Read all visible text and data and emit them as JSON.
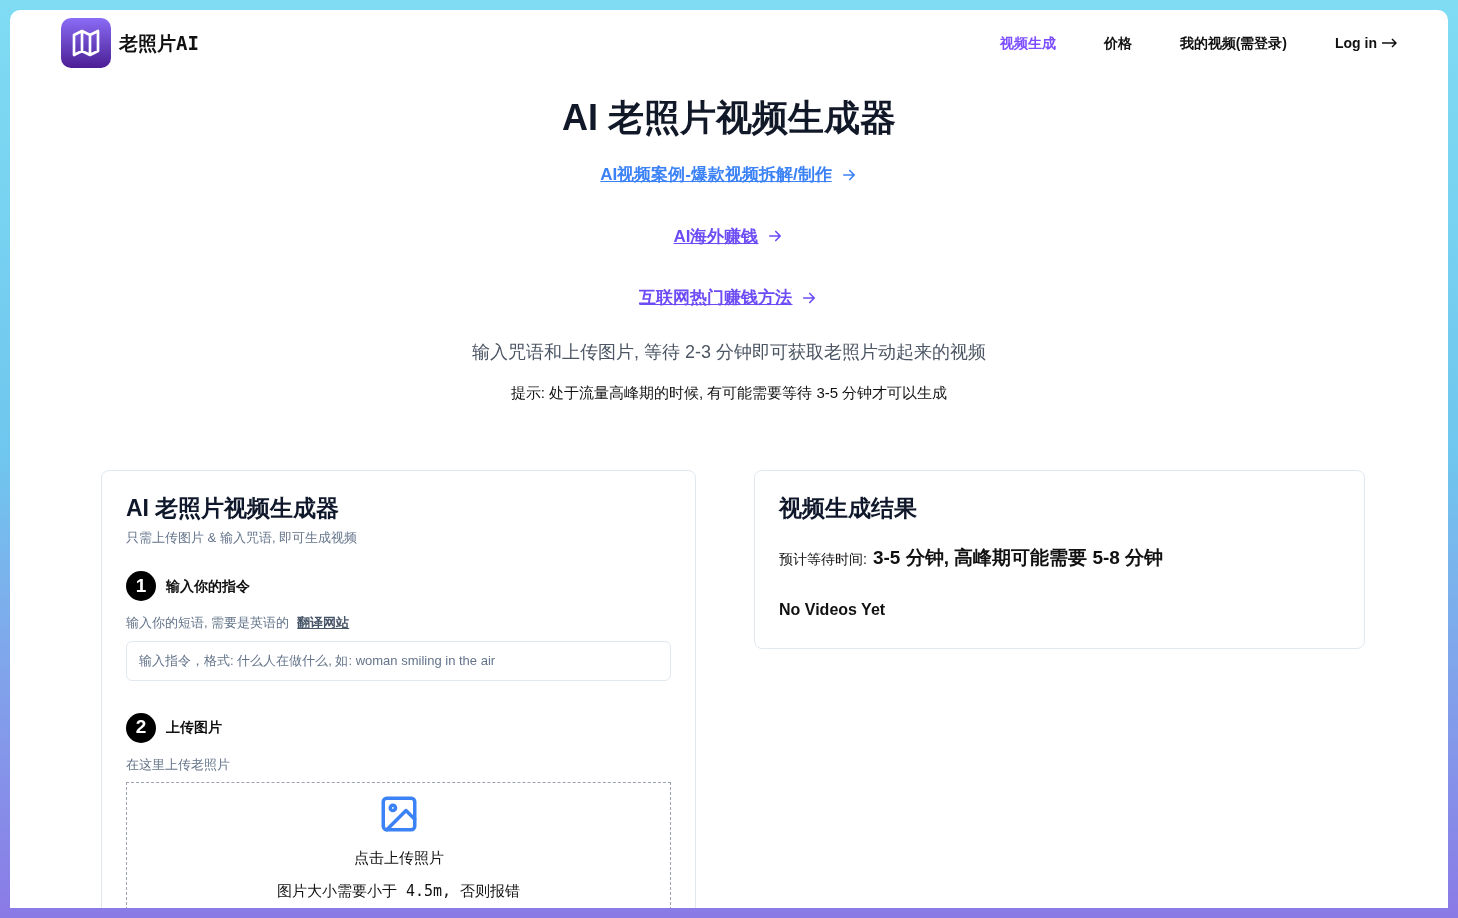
{
  "header": {
    "logo_text": "老照片AI",
    "nav": [
      {
        "label": "视频生成",
        "selected": true
      },
      {
        "label": "价格",
        "selected": false
      },
      {
        "label": "我的视频(需登录)",
        "selected": false
      }
    ],
    "login": "Log in"
  },
  "hero": {
    "title": "AI 老照片视频生成器",
    "links": [
      {
        "label": "AI视频案例-爆款视频拆解/制作",
        "color": "#3b82f6"
      },
      {
        "label": "AI海外赚钱",
        "color": "#6d4cf5"
      },
      {
        "label": "互联网热门赚钱方法",
        "color": "#6d4cf5"
      }
    ],
    "subtitle": "输入咒语和上传图片, 等待 2-3 分钟即可获取老照片动起来的视频",
    "tip": "提示: 处于流量高峰期的时候, 有可能需要等待 3-5 分钟才可以生成"
  },
  "generator": {
    "title": "AI 老照片视频生成器",
    "subtitle": "只需上传图片 & 输入咒语, 即可生成视频",
    "step1": {
      "number": "1",
      "title": "输入你的指令",
      "hint": "输入你的短语, 需要是英语的",
      "link": "翻译网站",
      "placeholder": "输入指令，格式: 什么人在做什么, 如: woman smiling in the air"
    },
    "step2": {
      "number": "2",
      "title": "上传图片",
      "hint": "在这里上传老照片",
      "upload_label": "点击上传照片",
      "upload_note": "图片大小需要小于 4.5m, 否则报错"
    }
  },
  "result": {
    "title": "视频生成结果",
    "wait_label": "预计等待时间:",
    "wait_value": "3-5 分钟, 高峰期可能需要 5-8 分钟",
    "empty": "No Videos Yet"
  }
}
